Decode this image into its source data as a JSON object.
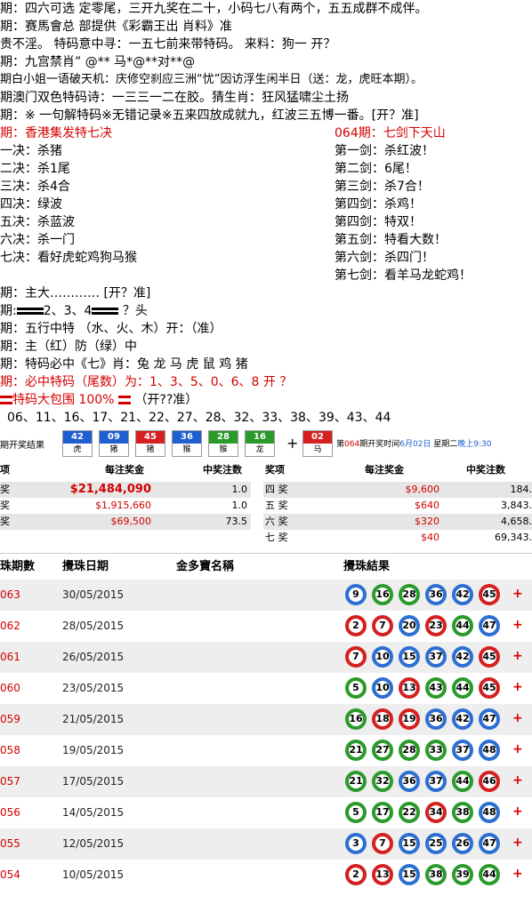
{
  "lines": [
    "期：四六可选 定零尾，三开九奖在二十，小码七八有两个，五五成群不成伴。",
    "期：赛馬會总 部提供《彩霸王出 肖料》准",
    "贵不淫。 特码意中寻：一五七前来带特码。 来料：狗一   开？",
    "期：九宫禁肖” @** 马*@**对**@",
    "期白小姐一语破天机：庆修空刹应三洲“忧”因访浮生闲半日（送：龙，虎旺本期）。",
    "期澳门双色特码诗：一三三一二在胶。猜生肖：狂风猛啸尘土扬",
    "期：※ 一句解特码※无错记录※五来四放成就九，红波三五博一番。[开？准]"
  ],
  "left_col": {
    "title": "期：香港集发特七决",
    "items": [
      "一决：杀猪",
      "二决：杀1尾",
      "三决：杀4合",
      "四决：绿波",
      "五决：杀蓝波",
      "六决：杀一门",
      "七决：看好虎蛇鸡狗马猴"
    ]
  },
  "right_col": {
    "title": "064期：七剑下天山",
    "items": [
      "第一剑：杀红波！",
      "第二剑：6尾！",
      "第三剑：杀7合！",
      "第四剑：杀鸡！",
      "第四剑：特双！",
      "第五剑：特看大数！",
      "第六剑：杀四门！",
      "第七剑：看羊马龙蛇鸡！"
    ]
  },
  "lines2": {
    "main_big": "期：主大………… [开？准]",
    "heads_pre": "期:",
    "heads_mid": "2、3、4",
    "heads_post": "？头",
    "five_elem": "期：五行中特  （水、火、木）开：（准）",
    "red_green": "期：主（红）防（绿）中",
    "seven": "期：特码必中《七》肖：兔 龙 马 虎 鼠 鸡  猪",
    "tail": "期：必中特码（尾数）为：1、3、5、0、6、8      开 ？",
    "package": "特码大包围 100%",
    "package_suffix": "（开??准）",
    "numbers": "06、11、16、17、21、22、27、28、32、33、38、39、43、44"
  },
  "strip": {
    "label": "期开奖结果",
    "balls": [
      {
        "num": "42",
        "zodiac": "虎",
        "color": "#1f5fd0"
      },
      {
        "num": "09",
        "zodiac": "猪",
        "color": "#1f5fd0"
      },
      {
        "num": "45",
        "zodiac": "猪",
        "color": "#d42020"
      },
      {
        "num": "36",
        "zodiac": "猴",
        "color": "#1f5fd0"
      },
      {
        "num": "28",
        "zodiac": "猴",
        "color": "#2a9a2a"
      },
      {
        "num": "16",
        "zodiac": "龙",
        "color": "#2a9a2a"
      }
    ],
    "plus": "+",
    "special": {
      "num": "02",
      "zodiac": "马",
      "color": "#d42020"
    },
    "next_pre": "第",
    "next_no": "064",
    "next_mid": "期开奖时间",
    "next_date": "6月02日",
    "next_day": "星期二",
    "next_time": "晚上9:30"
  },
  "prize": {
    "left_head": [
      "项",
      "每注奖金",
      "中奖注数"
    ],
    "right_head": [
      "奖项",
      "每注奖金",
      "中奖注数"
    ],
    "left_rows": [
      {
        "name": "奖",
        "amount": "$21,484,090",
        "count": "1.0"
      },
      {
        "name": "奖",
        "amount": "$1,915,660",
        "count": "1.0"
      },
      {
        "name": "奖",
        "amount": "$69,500",
        "count": "73.5"
      }
    ],
    "right_rows": [
      {
        "name": "四 奖",
        "amount": "$9,600",
        "count": "184."
      },
      {
        "name": "五 奖",
        "amount": "$640",
        "count": "3,843."
      },
      {
        "name": "六 奖",
        "amount": "$320",
        "count": "4,658."
      },
      {
        "name": "七 奖",
        "amount": "$40",
        "count": "69,343."
      }
    ]
  },
  "history": {
    "headers": [
      "珠期數",
      "攪珠日期",
      "金多寶名稱",
      "攪珠結果"
    ],
    "rows": [
      {
        "draw": "063",
        "date": "30/05/2015",
        "balls": [
          [
            "9",
            "blue"
          ],
          [
            "16",
            "green"
          ],
          [
            "28",
            "green"
          ],
          [
            "36",
            "blue"
          ],
          [
            "42",
            "blue"
          ],
          [
            "45",
            "red"
          ]
        ]
      },
      {
        "draw": "062",
        "date": "28/05/2015",
        "balls": [
          [
            "2",
            "red"
          ],
          [
            "7",
            "red"
          ],
          [
            "20",
            "blue"
          ],
          [
            "23",
            "red"
          ],
          [
            "44",
            "green"
          ],
          [
            "47",
            "blue"
          ]
        ]
      },
      {
        "draw": "061",
        "date": "26/05/2015",
        "balls": [
          [
            "7",
            "red"
          ],
          [
            "10",
            "blue"
          ],
          [
            "15",
            "blue"
          ],
          [
            "37",
            "blue"
          ],
          [
            "42",
            "blue"
          ],
          [
            "45",
            "red"
          ]
        ]
      },
      {
        "draw": "060",
        "date": "23/05/2015",
        "balls": [
          [
            "5",
            "green"
          ],
          [
            "10",
            "blue"
          ],
          [
            "13",
            "red"
          ],
          [
            "43",
            "green"
          ],
          [
            "44",
            "green"
          ],
          [
            "45",
            "red"
          ]
        ]
      },
      {
        "draw": "059",
        "date": "21/05/2015",
        "balls": [
          [
            "16",
            "green"
          ],
          [
            "18",
            "red"
          ],
          [
            "19",
            "red"
          ],
          [
            "36",
            "blue"
          ],
          [
            "42",
            "blue"
          ],
          [
            "47",
            "blue"
          ]
        ]
      },
      {
        "draw": "058",
        "date": "19/05/2015",
        "balls": [
          [
            "21",
            "green"
          ],
          [
            "27",
            "green"
          ],
          [
            "28",
            "green"
          ],
          [
            "33",
            "green"
          ],
          [
            "37",
            "blue"
          ],
          [
            "48",
            "blue"
          ]
        ]
      },
      {
        "draw": "057",
        "date": "17/05/2015",
        "balls": [
          [
            "21",
            "green"
          ],
          [
            "32",
            "green"
          ],
          [
            "36",
            "blue"
          ],
          [
            "37",
            "blue"
          ],
          [
            "44",
            "green"
          ],
          [
            "46",
            "red"
          ]
        ]
      },
      {
        "draw": "056",
        "date": "14/05/2015",
        "balls": [
          [
            "5",
            "green"
          ],
          [
            "17",
            "green"
          ],
          [
            "22",
            "green"
          ],
          [
            "34",
            "red"
          ],
          [
            "38",
            "green"
          ],
          [
            "48",
            "blue"
          ]
        ]
      },
      {
        "draw": "055",
        "date": "12/05/2015",
        "balls": [
          [
            "3",
            "blue"
          ],
          [
            "7",
            "red"
          ],
          [
            "15",
            "blue"
          ],
          [
            "25",
            "blue"
          ],
          [
            "26",
            "blue"
          ],
          [
            "47",
            "blue"
          ]
        ]
      },
      {
        "draw": "054",
        "date": "10/05/2015",
        "balls": [
          [
            "2",
            "red"
          ],
          [
            "13",
            "red"
          ],
          [
            "15",
            "blue"
          ],
          [
            "38",
            "green"
          ],
          [
            "39",
            "green"
          ],
          [
            "44",
            "green"
          ]
        ]
      }
    ]
  }
}
